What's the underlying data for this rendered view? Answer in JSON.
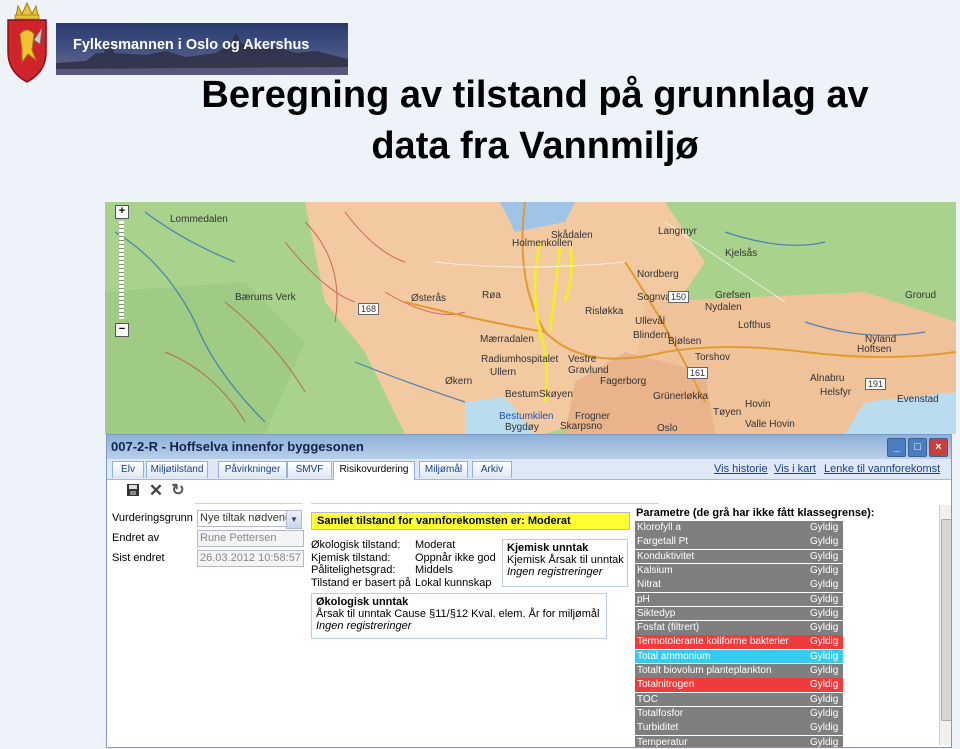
{
  "header": {
    "org_name": "Fylkesmannen i Oslo og Akershus",
    "title_line1": "Beregning av tilstand på grunnlag av",
    "title_line2": "data fra Vannmiljø"
  },
  "map": {
    "zoom_in": "+",
    "zoom_out": "−",
    "labels": [
      {
        "text": "Lommedalen",
        "style": "dark"
      },
      {
        "text": "Skådalen",
        "style": "dark"
      },
      {
        "text": "Holmenkollen",
        "style": "dark"
      },
      {
        "text": "Langmyr",
        "style": "dark"
      },
      {
        "text": "Kjelsås",
        "style": "dark"
      },
      {
        "text": "Nordberg",
        "style": "dark"
      },
      {
        "text": "Bærums Verk",
        "style": "dark"
      },
      {
        "text": "Østerås",
        "style": "dark"
      },
      {
        "text": "Røa",
        "style": "dark"
      },
      {
        "text": "Grefsen",
        "style": "dark"
      },
      {
        "text": "Nydalen",
        "style": "dark"
      },
      {
        "text": "Sognvann",
        "style": "dark"
      },
      {
        "text": "Grorud",
        "style": "dark"
      },
      {
        "text": "Ullevål",
        "style": "dark"
      },
      {
        "text": "Risløkka",
        "style": "dark"
      },
      {
        "text": "Lofthus",
        "style": "dark"
      },
      {
        "text": "Mærradalen",
        "style": "dark"
      },
      {
        "text": "Blindern",
        "style": "dark"
      },
      {
        "text": "Bjølsen",
        "style": "dark"
      },
      {
        "text": "Torshov",
        "style": "dark"
      },
      {
        "text": "Nyland",
        "style": "dark"
      },
      {
        "text": "Radiumhospitalet",
        "style": "dark"
      },
      {
        "text": "Vestre Gravlund",
        "style": "dark"
      },
      {
        "text": "Hoftsen",
        "style": "dark"
      },
      {
        "text": "Økern",
        "style": "dark"
      },
      {
        "text": "Ullern",
        "style": "dark"
      },
      {
        "text": "Fagerborg",
        "style": "dark"
      },
      {
        "text": "Alnabru",
        "style": "dark"
      },
      {
        "text": "Bestum",
        "style": "dark"
      },
      {
        "text": "Skøyen",
        "style": "dark"
      },
      {
        "text": "Grünerløkka",
        "style": "dark"
      },
      {
        "text": "Helsfyr",
        "style": "dark"
      },
      {
        "text": "Bestumkilen",
        "style": "blue"
      },
      {
        "text": "Frogner",
        "style": "dark"
      },
      {
        "text": "Tøyen",
        "style": "dark"
      },
      {
        "text": "Bygdøy",
        "style": "dark"
      },
      {
        "text": "Skarpsno",
        "style": "dark"
      },
      {
        "text": "Oslo",
        "style": "dark"
      },
      {
        "text": "Valle Hovin",
        "style": "dark"
      },
      {
        "text": "Hovin",
        "style": "dark"
      },
      {
        "text": "Evenstad",
        "style": "dark"
      },
      {
        "text": "168",
        "style": "road"
      },
      {
        "text": "150",
        "style": "road"
      },
      {
        "text": "161",
        "style": "road"
      },
      {
        "text": "191",
        "style": "road"
      }
    ]
  },
  "window": {
    "title": "007-2-R - Hoffselva innenfor byggesonen",
    "tabs": [
      "Elv",
      "Miljøtilstand",
      "Påvirkninger",
      "SMVF",
      "Risikovurdering",
      "Miljømål",
      "Arkiv"
    ],
    "active_tab": "Risikovurdering",
    "links": [
      "Vis historie",
      "Vis i kart",
      "Lenke til vannforekomst"
    ],
    "form": {
      "vurdering_label": "Vurderingsgrunn",
      "vurdering_value": "Nye tiltak nødvendig",
      "endret_label": "Endret av",
      "endret_value": "Rune Pettersen",
      "sist_label": "Sist endret",
      "sist_value": "26.03.2012 10:58:57"
    },
    "samlet": "Samlet tilstand for vannforekomsten er:  Moderat",
    "status": [
      {
        "k": "Økologisk tilstand:",
        "v": "Moderat"
      },
      {
        "k": "Kjemisk tilstand:",
        "v": "Oppnår ikke god"
      },
      {
        "k": "Pålitelighetsgrad:",
        "v": "Middels"
      },
      {
        "k": "Tilstand er basert på",
        "v": "Lokal kunnskap"
      }
    ],
    "kjemisk_unntak": {
      "heading": "Kjemisk unntak",
      "line": "Kjemisk Årsak til unntak",
      "none": "Ingen registreringer"
    },
    "okologisk_unntak": {
      "heading": "Økologisk unntak",
      "line": "Årsak til unntak Cause §11/§12 Kval. elem. År for miljømål",
      "none": "Ingen registreringer"
    },
    "params_heading": "Parametre (de grå har ikke fått klassegrense):",
    "params": [
      {
        "name": "Klorofyll a",
        "status": "Gyldig",
        "color": "#7f7f7f"
      },
      {
        "name": "Fargetall Pt",
        "status": "Gyldig",
        "color": "#7f7f7f"
      },
      {
        "name": "Konduktivitet",
        "status": "Gyldig",
        "color": "#7f7f7f"
      },
      {
        "name": "Kalsium",
        "status": "Gyldig",
        "color": "#7f7f7f"
      },
      {
        "name": "Nitrat",
        "status": "Gyldig",
        "color": "#7f7f7f"
      },
      {
        "name": "pH",
        "status": "Gyldig",
        "color": "#7f7f7f"
      },
      {
        "name": "Siktedyp",
        "status": "Gyldig",
        "color": "#7f7f7f"
      },
      {
        "name": "Fosfat (filtrert)",
        "status": "Gyldig",
        "color": "#7f7f7f"
      },
      {
        "name": "Termotolerante koliforme bakterier",
        "status": "Gyldig",
        "color": "#ef3b3b"
      },
      {
        "name": "Total ammonium",
        "status": "Gyldig",
        "color": "#33ccee"
      },
      {
        "name": "Totalt biovolum planteplankton",
        "status": "Gyldig",
        "color": "#7f7f7f"
      },
      {
        "name": "Totalnitrogen",
        "status": "Gyldig",
        "color": "#ef3b3b"
      },
      {
        "name": "TOC",
        "status": "Gyldig",
        "color": "#7f7f7f"
      },
      {
        "name": "Totalfosfor",
        "status": "Gyldig",
        "color": "#7f7f7f"
      },
      {
        "name": "Turbiditet",
        "status": "Gyldig",
        "color": "#7f7f7f"
      },
      {
        "name": "Temperatur",
        "status": "Gyldig",
        "color": "#7f7f7f"
      }
    ]
  }
}
